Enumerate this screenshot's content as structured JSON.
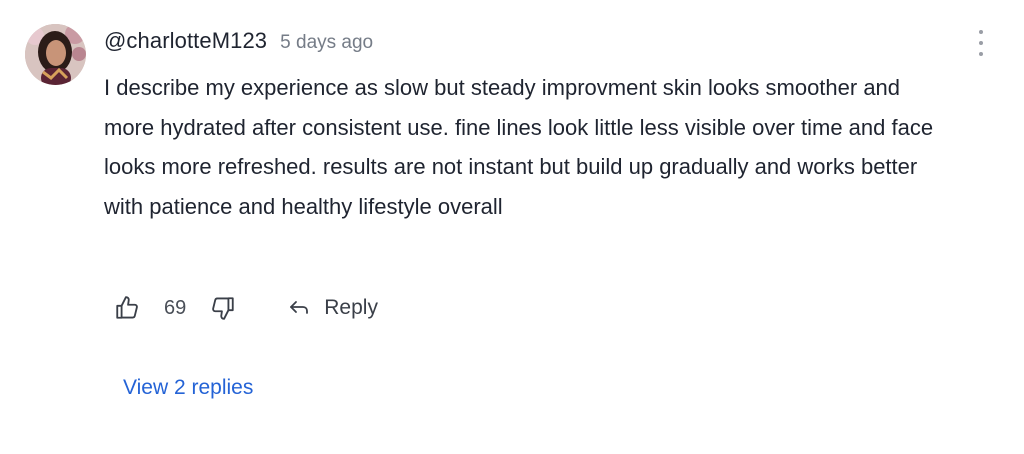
{
  "comment": {
    "username": "@charlotteM123",
    "timestamp": "5 days ago",
    "text": "I describe my experience as slow but steady improvment skin looks smoother and more hydrated after consistent use. fine lines look little less visible over time and face looks more refreshed. results are not instant but build up gradually and works better with patience and healthy lifestyle overall",
    "likes": "69",
    "reply_label": "Reply",
    "view_replies_label": "View 2 replies"
  },
  "icons": {
    "avatar": "user-avatar",
    "menu": "more-vertical-icon",
    "like": "thumbs-up-icon",
    "dislike": "thumbs-down-icon",
    "reply": "reply-arrow-icon"
  },
  "colors": {
    "text": "#1f2430",
    "muted": "#757c87",
    "link": "#2463d6"
  }
}
